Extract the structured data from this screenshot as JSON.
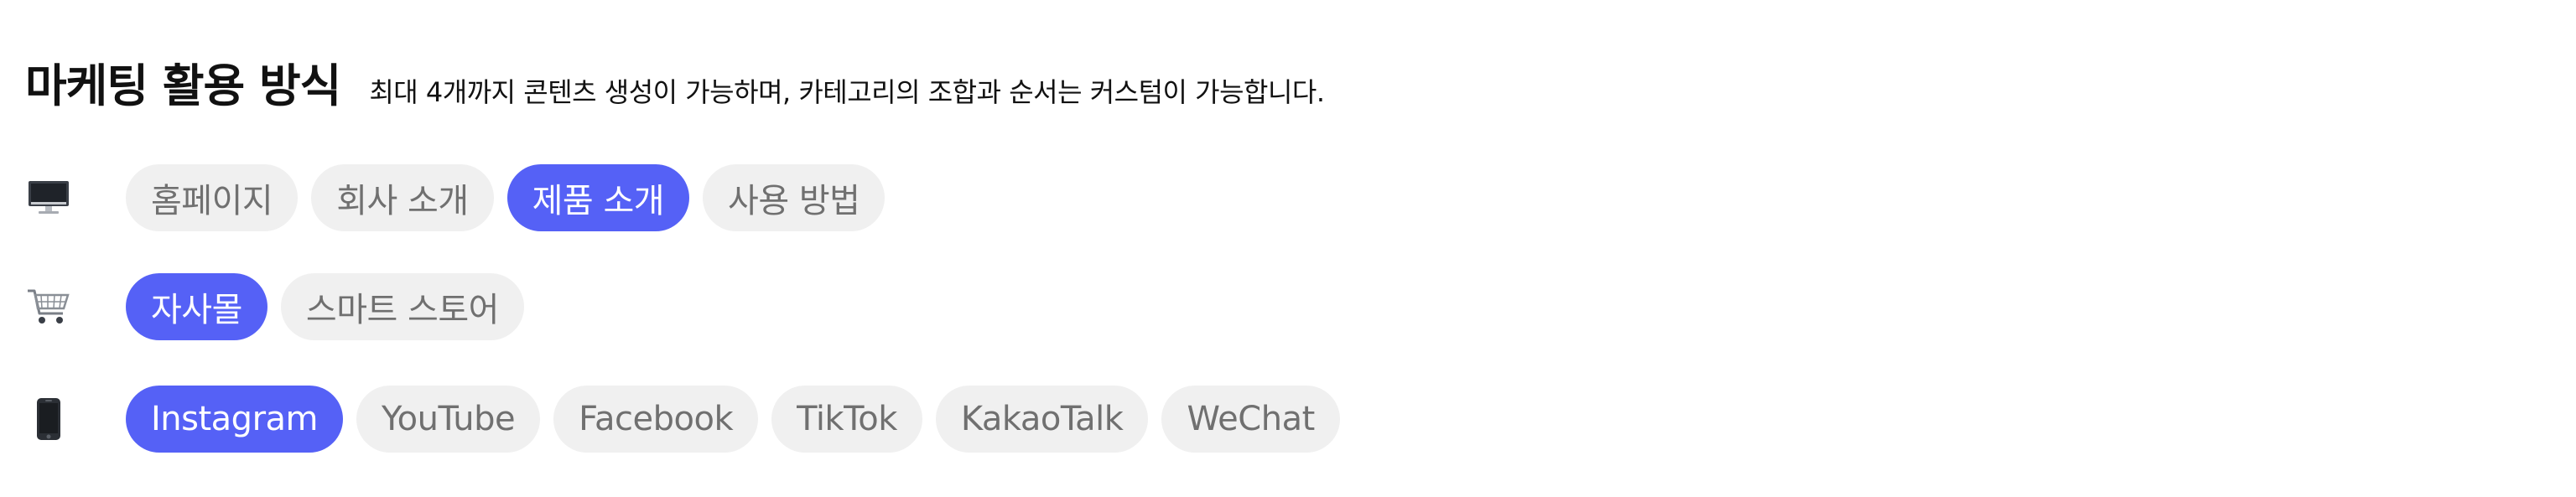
{
  "header": {
    "title": "마케팅 활용 방식",
    "subtitle": "최대 4개까지 콘텐츠 생성이 가능하며, 카테고리의 조합과 순서는 커스텀이 가능합니다."
  },
  "colors": {
    "accent": "#5561f6",
    "chip_bg": "#f0f0f0",
    "chip_text": "#707070"
  },
  "rows": [
    {
      "icon": "desktop-computer-icon",
      "chips": [
        {
          "label": "홈페이지",
          "selected": false
        },
        {
          "label": "회사 소개",
          "selected": false
        },
        {
          "label": "제품 소개",
          "selected": true
        },
        {
          "label": "사용 방법",
          "selected": false
        }
      ]
    },
    {
      "icon": "shopping-cart-icon",
      "chips": [
        {
          "label": "자사몰",
          "selected": true
        },
        {
          "label": "스마트 스토어",
          "selected": false
        }
      ]
    },
    {
      "icon": "mobile-phone-icon",
      "chips": [
        {
          "label": "Instagram",
          "selected": true
        },
        {
          "label": "YouTube",
          "selected": false
        },
        {
          "label": "Facebook",
          "selected": false
        },
        {
          "label": "TikTok",
          "selected": false
        },
        {
          "label": "KakaoTalk",
          "selected": false
        },
        {
          "label": "WeChat",
          "selected": false
        }
      ]
    }
  ]
}
